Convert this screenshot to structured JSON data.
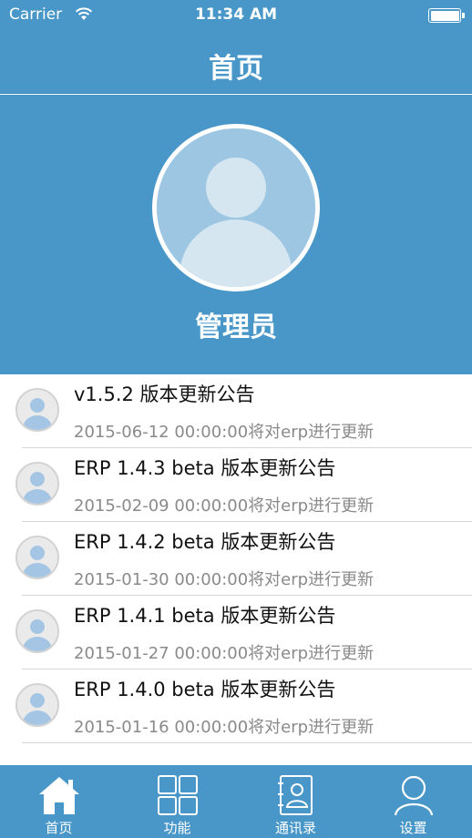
{
  "status_bar": {
    "carrier": "Carrier",
    "time": "11:34 AM",
    "icons": [
      "wifi-icon",
      "battery-icon"
    ]
  },
  "nav": {
    "title": "首页"
  },
  "profile": {
    "username": "管理员",
    "avatar_icon": "user-avatar-icon"
  },
  "news": [
    {
      "title": "v1.5.2 版本更新公告",
      "subtitle": "2015-06-12 00:00:00将对erp进行更新"
    },
    {
      "title": "ERP 1.4.3 beta 版本更新公告",
      "subtitle": "2015-02-09 00:00:00将对erp进行更新"
    },
    {
      "title": "ERP 1.4.2 beta 版本更新公告",
      "subtitle": "2015-01-30 00:00:00将对erp进行更新"
    },
    {
      "title": "ERP 1.4.1 beta 版本更新公告",
      "subtitle": "2015-01-27 00:00:00将对erp进行更新"
    },
    {
      "title": "ERP 1.4.0 beta 版本更新公告",
      "subtitle": "2015-01-16 00:00:00将对erp进行更新"
    }
  ],
  "tabs": [
    {
      "label": "首页",
      "icon": "home-icon",
      "selected": true
    },
    {
      "label": "功能",
      "icon": "grid-icon",
      "selected": false
    },
    {
      "label": "通讯录",
      "icon": "contacts-book-icon",
      "selected": false
    },
    {
      "label": "设置",
      "icon": "person-icon",
      "selected": false
    }
  ],
  "colors": {
    "primary": "#4897c8",
    "avatar_fill": "#9cc6e2",
    "text": "#111111",
    "subtext": "#8a8a8a"
  }
}
